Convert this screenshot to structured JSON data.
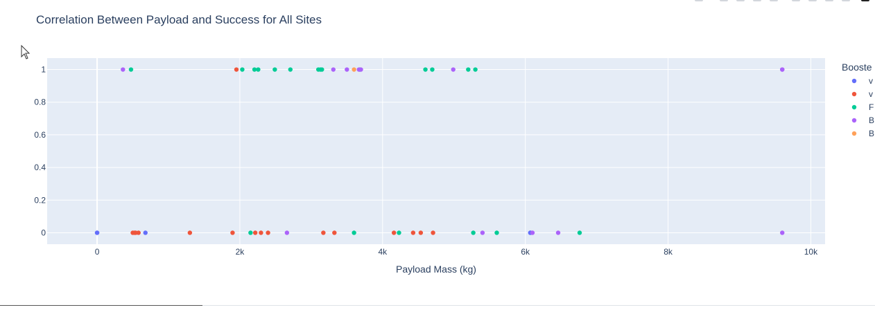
{
  "chart_data": {
    "type": "scatter",
    "title": "Correlation Between Payload and Success for All Sites",
    "xlabel": "Payload Mass (kg)",
    "ylabel": "",
    "xlim": [
      -700,
      10200
    ],
    "ylim": [
      -0.07,
      1.07
    ],
    "x_ticks": [
      0,
      2000,
      4000,
      6000,
      8000,
      10000
    ],
    "x_tick_labels": [
      "0",
      "2k",
      "4k",
      "6k",
      "8k",
      "10k"
    ],
    "y_ticks": [
      0,
      0.2,
      0.4,
      0.6,
      0.8,
      1
    ],
    "y_tick_labels": [
      "0",
      "0.2",
      "0.4",
      "0.6",
      "0.8",
      "1"
    ],
    "grid": true,
    "legend_title": "Booste",
    "legend_labels": [
      "v",
      "v",
      "F",
      "B",
      "B"
    ],
    "legend_position": "right",
    "series": [
      {
        "color": "#636efa",
        "points": [
          [
            0,
            0
          ],
          [
            0,
            0
          ],
          [
            677,
            0
          ],
          [
            6070,
            0
          ],
          [
            6070,
            0
          ]
        ]
      },
      {
        "color": "#ef553b",
        "points": [
          [
            1952,
            1
          ],
          [
            525,
            0
          ],
          [
            500,
            0
          ],
          [
            540,
            0
          ],
          [
            580,
            0
          ],
          [
            1300,
            0
          ],
          [
            1898,
            0
          ],
          [
            2216,
            0
          ],
          [
            2296,
            0
          ],
          [
            2395,
            0
          ],
          [
            3170,
            0
          ],
          [
            3325,
            0
          ],
          [
            4159,
            0
          ],
          [
            4428,
            0
          ],
          [
            4535,
            0
          ],
          [
            4707,
            0
          ]
        ]
      },
      {
        "color": "#00cc96",
        "points": [
          [
            475,
            1
          ],
          [
            2034,
            1
          ],
          [
            2205,
            1
          ],
          [
            2257,
            1
          ],
          [
            2490,
            1
          ],
          [
            2708,
            1
          ],
          [
            3100,
            1
          ],
          [
            3130,
            1
          ],
          [
            3150,
            1
          ],
          [
            3681,
            1
          ],
          [
            4600,
            1
          ],
          [
            4696,
            1
          ],
          [
            5200,
            1
          ],
          [
            5300,
            1
          ],
          [
            2150,
            0
          ],
          [
            3600,
            0
          ],
          [
            4230,
            0
          ],
          [
            5271,
            0
          ],
          [
            5600,
            0
          ],
          [
            6761,
            0
          ]
        ]
      },
      {
        "color": "#ab63fa",
        "points": [
          [
            362,
            1
          ],
          [
            3310,
            1
          ],
          [
            3500,
            1
          ],
          [
            3669,
            1
          ],
          [
            3696,
            1
          ],
          [
            4990,
            1
          ],
          [
            9600,
            1
          ],
          [
            9600,
            1
          ],
          [
            2660,
            0
          ],
          [
            5400,
            0
          ],
          [
            6100,
            0
          ],
          [
            6460,
            0
          ],
          [
            9600,
            0
          ]
        ]
      },
      {
        "color": "#ffa15a",
        "points": [
          [
            3600,
            1
          ]
        ]
      }
    ]
  }
}
